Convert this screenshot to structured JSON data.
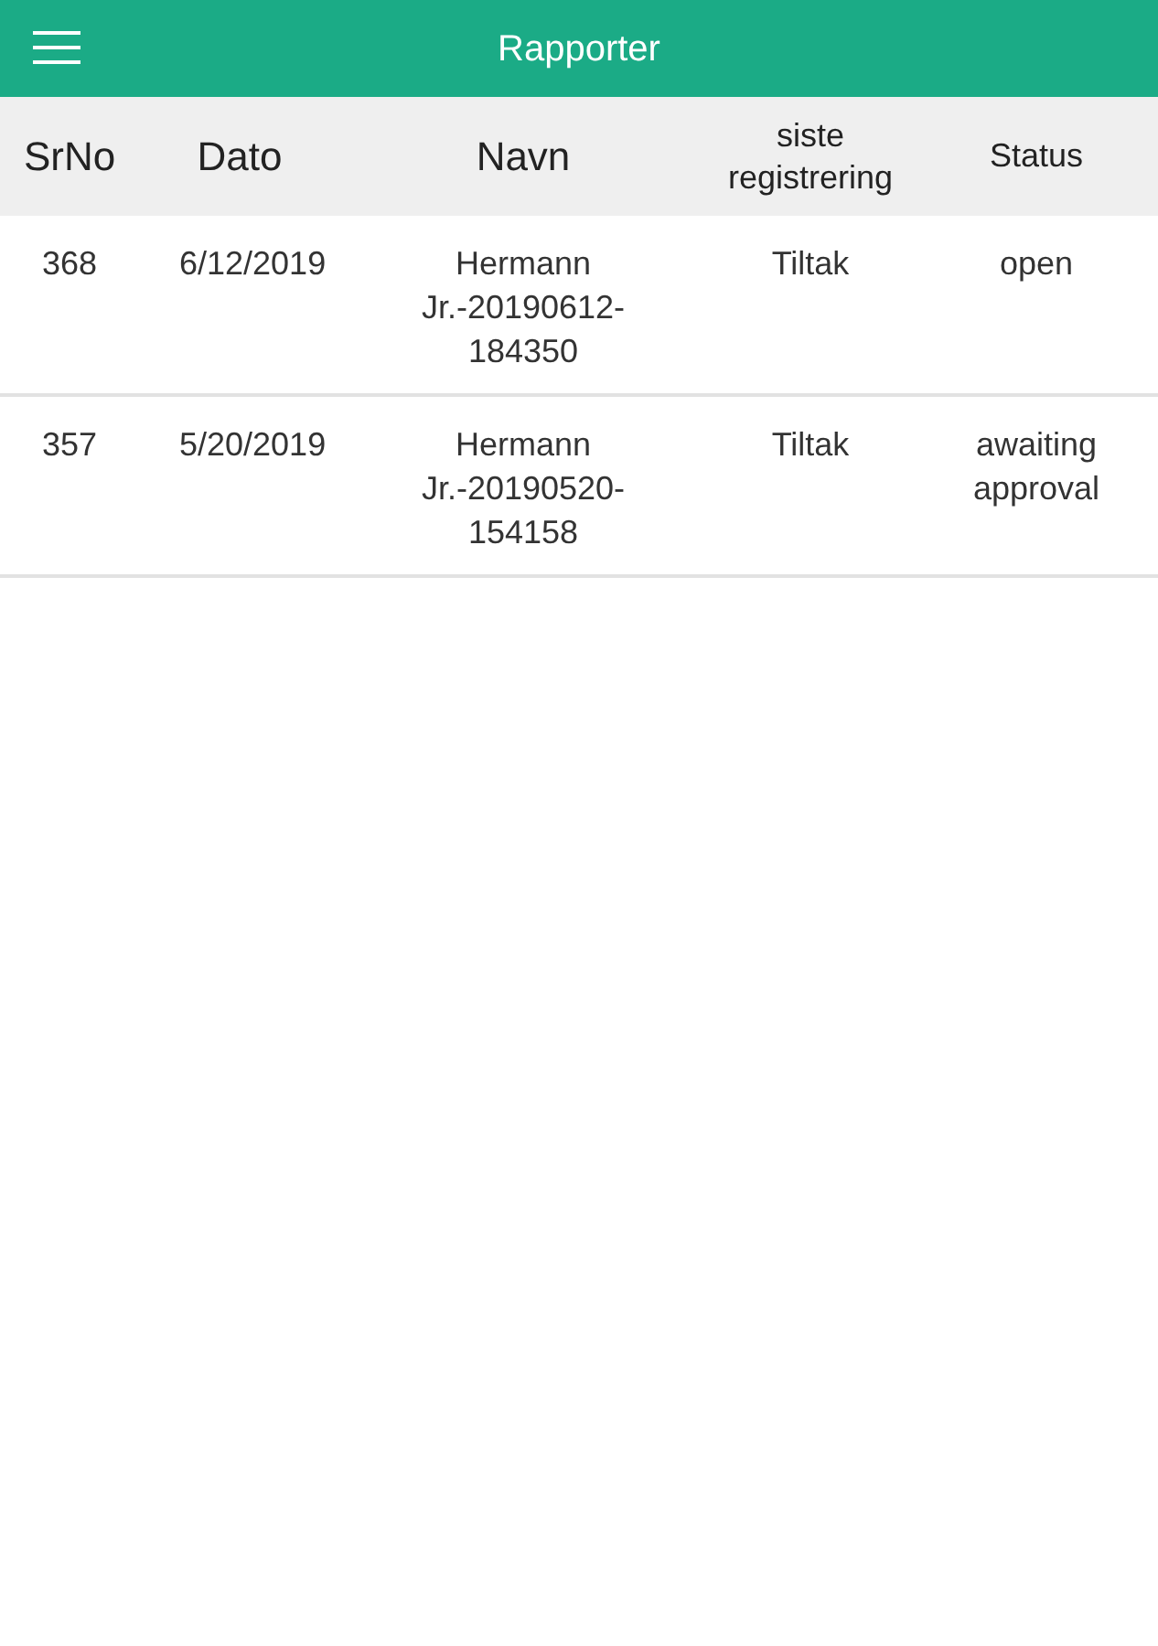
{
  "app_bar": {
    "title": "Rapporter"
  },
  "table": {
    "columns": [
      "SrNo",
      "Dato",
      "Navn",
      "siste registrering",
      "Status"
    ],
    "rows": [
      [
        "368",
        "6/12/2019",
        "Hermann Jr.-20190612-184350",
        "Tiltak",
        "open"
      ],
      [
        "357",
        "5/20/2019",
        "Hermann Jr.-20190520-154158",
        "Tiltak",
        "awaiting approval"
      ]
    ]
  }
}
